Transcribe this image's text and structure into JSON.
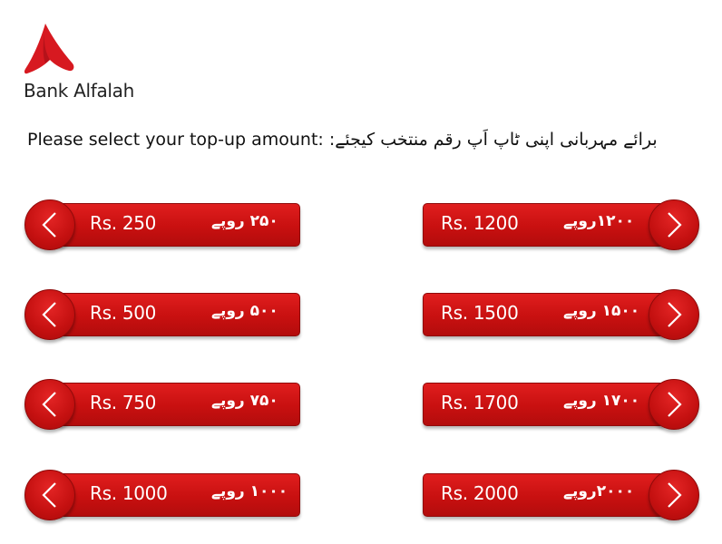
{
  "brand": {
    "name": "Bank Alfalah",
    "color": "#d71920"
  },
  "prompt": {
    "english": "Please select your top-up amount:",
    "urdu": "برائے مہربانی اپنی ٹاپ اَپ رقم منتخب کیجئے:"
  },
  "icons": {
    "logo": "bank-alfalah-logo",
    "left_arrow": "chevron-left-icon",
    "right_arrow": "chevron-right-icon"
  },
  "options": {
    "left": [
      {
        "english": "Rs. 250",
        "urdu": "۲۵۰ روپے"
      },
      {
        "english": "Rs. 500",
        "urdu": "۵۰۰ روپے"
      },
      {
        "english": "Rs. 750",
        "urdu": "۷۵۰ روپے"
      },
      {
        "english": "Rs. 1000",
        "urdu": "۱۰۰۰ روپے"
      }
    ],
    "right": [
      {
        "english": "Rs. 1200",
        "urdu": "۱۲۰۰روپے"
      },
      {
        "english": "Rs. 1500",
        "urdu": "۱۵۰۰ روپے"
      },
      {
        "english": "Rs. 1700",
        "urdu": "۱۷۰۰ روپے"
      },
      {
        "english": "Rs. 2000",
        "urdu": "۲۰۰۰روپے"
      }
    ]
  }
}
